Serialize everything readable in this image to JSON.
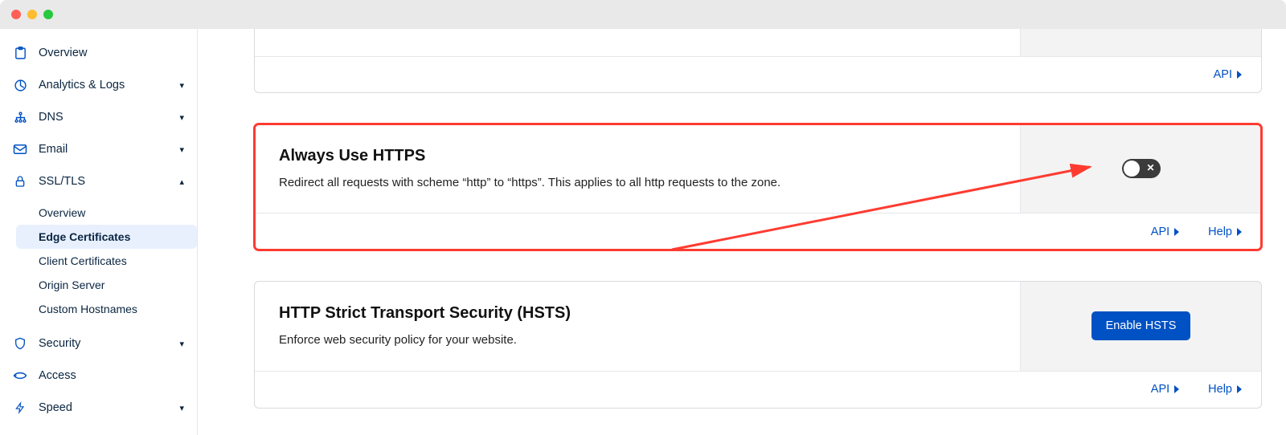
{
  "sidebar": {
    "items": [
      {
        "label": "Overview",
        "icon": "overview-icon",
        "expandable": false
      },
      {
        "label": "Analytics & Logs",
        "icon": "analytics-icon",
        "expandable": true
      },
      {
        "label": "DNS",
        "icon": "dns-icon",
        "expandable": true
      },
      {
        "label": "Email",
        "icon": "email-icon",
        "expandable": true
      },
      {
        "label": "SSL/TLS",
        "icon": "lock-icon",
        "expandable": true,
        "expanded": true,
        "children": [
          {
            "label": "Overview"
          },
          {
            "label": "Edge Certificates",
            "active": true
          },
          {
            "label": "Client Certificates"
          },
          {
            "label": "Origin Server"
          },
          {
            "label": "Custom Hostnames"
          }
        ]
      },
      {
        "label": "Security",
        "icon": "shield-icon",
        "expandable": true
      },
      {
        "label": "Access",
        "icon": "access-icon",
        "expandable": false
      },
      {
        "label": "Speed",
        "icon": "speed-icon",
        "expandable": true
      }
    ]
  },
  "card_top": {
    "api": "API"
  },
  "card_always_https": {
    "title": "Always Use HTTPS",
    "desc": "Redirect all requests with scheme “http” to “https”. This applies to all http requests to the zone.",
    "toggle_on": false,
    "api": "API",
    "help": "Help"
  },
  "card_hsts": {
    "title": "HTTP Strict Transport Security (HSTS)",
    "desc": "Enforce web security policy for your website.",
    "button": "Enable HSTS",
    "api": "API",
    "help": "Help"
  },
  "annotation": {
    "highlight_card": "always-use-https",
    "arrow": true
  }
}
